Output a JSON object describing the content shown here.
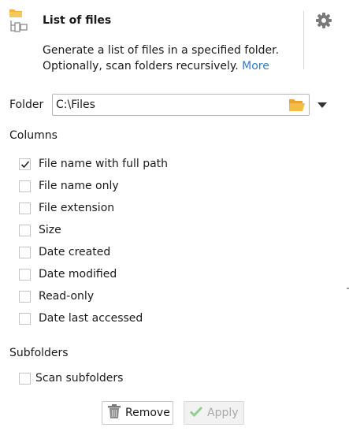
{
  "header": {
    "title": "List of files",
    "description": "Generate a list of files in a specified folder. Optionally, scan folders recursively.",
    "more_link": "More",
    "app_icon": "folder-list-icon",
    "settings_icon": "gear-icon"
  },
  "folder": {
    "label": "Folder",
    "value": "C:\\Files",
    "browse_icon": "open-folder-icon",
    "dropdown_icon": "chevron-down-icon"
  },
  "columns": {
    "title": "Columns",
    "items": [
      {
        "label": "File name with full path",
        "checked": true
      },
      {
        "label": "File name only",
        "checked": false
      },
      {
        "label": "File extension",
        "checked": false
      },
      {
        "label": "Size",
        "checked": false
      },
      {
        "label": "Date created",
        "checked": false
      },
      {
        "label": "Date modified",
        "checked": false
      },
      {
        "label": "Read-only",
        "checked": false
      },
      {
        "label": "Date last accessed",
        "checked": false
      }
    ]
  },
  "subfolders": {
    "title": "Subfolders",
    "scan_label": "Scan subfolders",
    "scan_checked": false
  },
  "buttons": {
    "remove": "Remove",
    "apply": "Apply",
    "apply_enabled": false
  },
  "colors": {
    "link": "#2a7fd1",
    "folder_icon": "#f0b33c",
    "apply_check": "#8fd18f"
  }
}
